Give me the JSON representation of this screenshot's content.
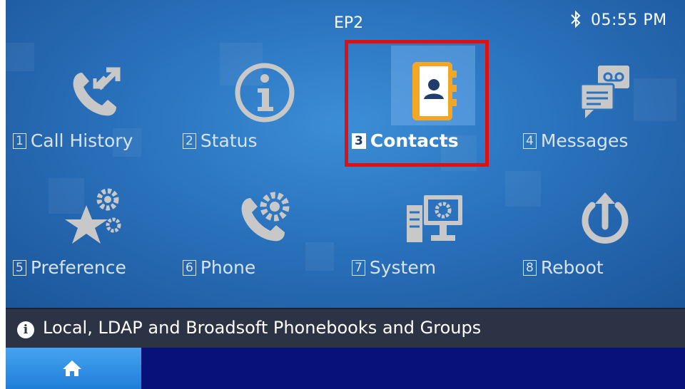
{
  "status_bar": {
    "title": "EP2",
    "time": "05:55 PM",
    "bluetooth_icon": "bluetooth-icon"
  },
  "apps": [
    {
      "number": "1",
      "label": "Call History",
      "icon": "call-history-icon",
      "selected": false
    },
    {
      "number": "2",
      "label": "Status",
      "icon": "info-circle-icon",
      "selected": false
    },
    {
      "number": "3",
      "label": "Contacts",
      "icon": "contacts-book-icon",
      "selected": true
    },
    {
      "number": "4",
      "label": "Messages",
      "icon": "voicemail-messages-icon",
      "selected": false
    },
    {
      "number": "5",
      "label": "Preference",
      "icon": "star-gears-icon",
      "selected": false
    },
    {
      "number": "6",
      "label": "Phone",
      "icon": "phone-gear-icon",
      "selected": false
    },
    {
      "number": "7",
      "label": "System",
      "icon": "computer-gear-icon",
      "selected": false
    },
    {
      "number": "8",
      "label": "Reboot",
      "icon": "power-reboot-icon",
      "selected": false
    }
  ],
  "info_bar": {
    "text": "Local, LDAP and Broadsoft Phonebooks and Groups",
    "icon": "info-icon"
  },
  "nav": {
    "home_icon": "home-icon"
  },
  "colors": {
    "background": "#2a72bd",
    "icon_gray": "#c8c8c8",
    "selection_border": "#e01010",
    "contacts_orange": "#f5a623",
    "nav_bar": "#06127a",
    "home_tab": "#2f8fe6"
  }
}
